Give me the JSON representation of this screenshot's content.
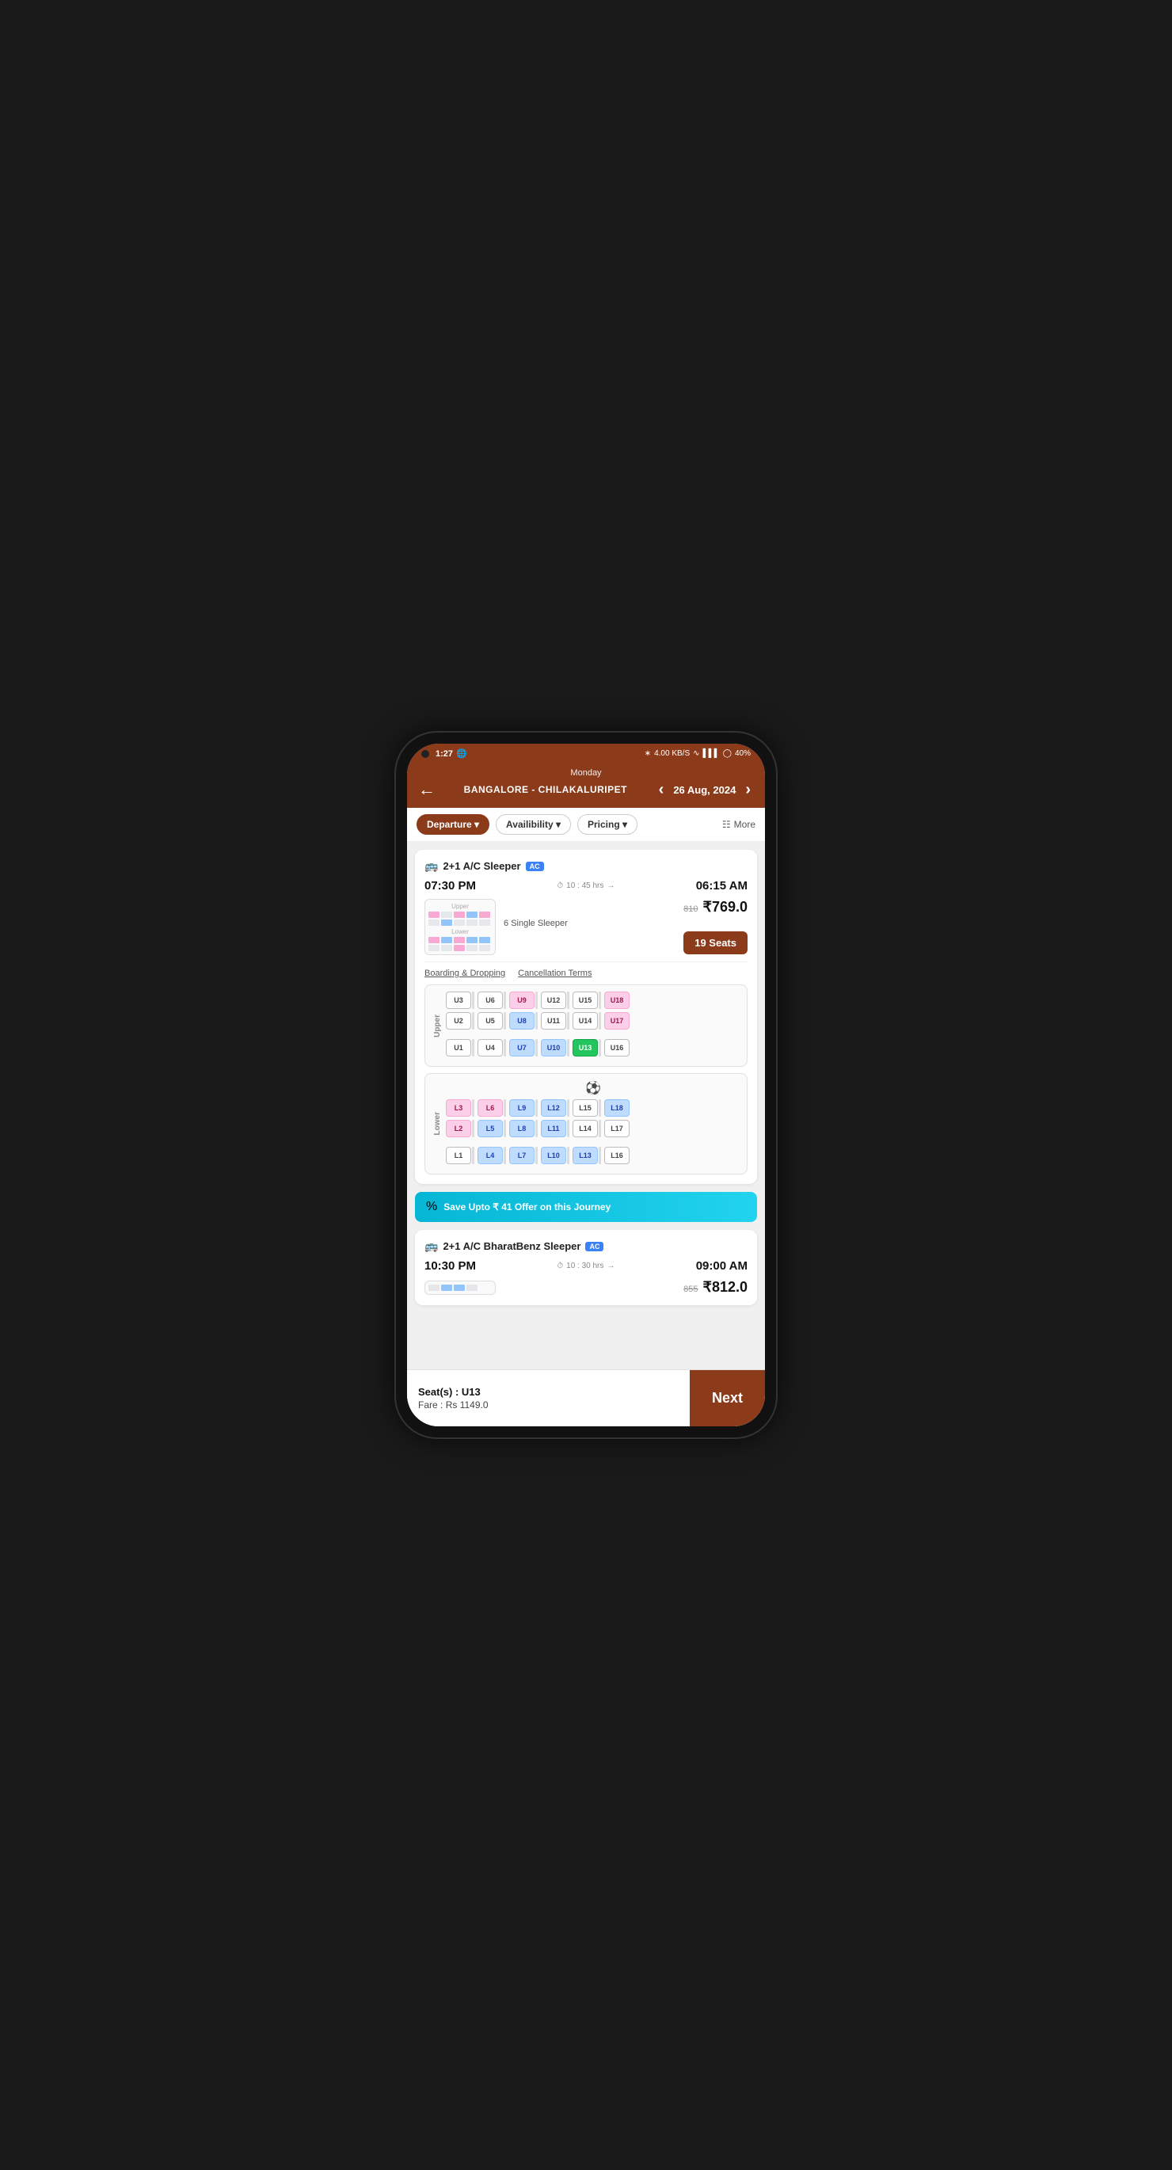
{
  "statusBar": {
    "time": "1:27",
    "battery": "40%",
    "signal": "4.00 KB/S"
  },
  "header": {
    "dayLabel": "Monday",
    "date": "26 Aug, 2024",
    "route": "BANGALORE - CHILAKALURIPET"
  },
  "filters": {
    "departure": "Departure ▾",
    "availability": "Availibility ▾",
    "pricing": "Pricing ▾",
    "more": "More"
  },
  "bus1": {
    "type": "2+1 A/C Sleeper",
    "acBadge": "AC",
    "departTime": "07:30 PM",
    "duration": "10 : 45 hrs",
    "arriveTime": "06:15 AM",
    "originalPrice": "810",
    "currentPrice": "₹769.0",
    "singleSleeperCount": "6",
    "singleSleeperLabel": "Single Sleeper",
    "seatsLabel": "19 Seats",
    "boardingLink": "Boarding & Dropping",
    "cancellationLink": "Cancellation Terms",
    "upperSeats": [
      {
        "id": "U3",
        "status": "available"
      },
      {
        "id": "U6",
        "status": "available"
      },
      {
        "id": "U9",
        "status": "pink"
      },
      {
        "id": "U12",
        "status": "available"
      },
      {
        "id": "U15",
        "status": "available"
      },
      {
        "id": "U18",
        "status": "pink"
      },
      {
        "id": "U2",
        "status": "available"
      },
      {
        "id": "U5",
        "status": "available"
      },
      {
        "id": "U8",
        "status": "blue"
      },
      {
        "id": "U11",
        "status": "available"
      },
      {
        "id": "U14",
        "status": "available"
      },
      {
        "id": "U17",
        "status": "pink"
      },
      {
        "id": "U1",
        "status": "available"
      },
      {
        "id": "U4",
        "status": "available"
      },
      {
        "id": "U7",
        "status": "blue"
      },
      {
        "id": "U10",
        "status": "blue"
      },
      {
        "id": "U13",
        "status": "green"
      },
      {
        "id": "U16",
        "status": "available"
      }
    ],
    "lowerSeats": [
      {
        "id": "L3",
        "status": "pink"
      },
      {
        "id": "L6",
        "status": "pink"
      },
      {
        "id": "L9",
        "status": "blue"
      },
      {
        "id": "L12",
        "status": "blue"
      },
      {
        "id": "L15",
        "status": "available"
      },
      {
        "id": "L18",
        "status": "blue"
      },
      {
        "id": "L2",
        "status": "pink"
      },
      {
        "id": "L5",
        "status": "blue"
      },
      {
        "id": "L8",
        "status": "blue"
      },
      {
        "id": "L11",
        "status": "blue"
      },
      {
        "id": "L14",
        "status": "available"
      },
      {
        "id": "L17",
        "status": "available"
      },
      {
        "id": "L1",
        "status": "available"
      },
      {
        "id": "L4",
        "status": "blue"
      },
      {
        "id": "L7",
        "status": "blue"
      },
      {
        "id": "L10",
        "status": "blue"
      },
      {
        "id": "L13",
        "status": "blue"
      },
      {
        "id": "L16",
        "status": "available"
      }
    ]
  },
  "offerBanner": {
    "text": "Save Upto ₹ 41 Offer on this Journey"
  },
  "bus2": {
    "type": "2+1 A/C BharatBenz Sleeper",
    "acBadge": "AC",
    "departTime": "10:30 PM",
    "duration": "10 : 30 hrs",
    "arriveTime": "09:00 AM",
    "originalPrice": "855",
    "currentPrice": "₹812.0"
  },
  "bottomBar": {
    "seatsLabel": "Seat(s) : U13",
    "fareLabel": "Fare",
    "fareValue": ": Rs 1149.0",
    "nextBtn": "Next"
  }
}
